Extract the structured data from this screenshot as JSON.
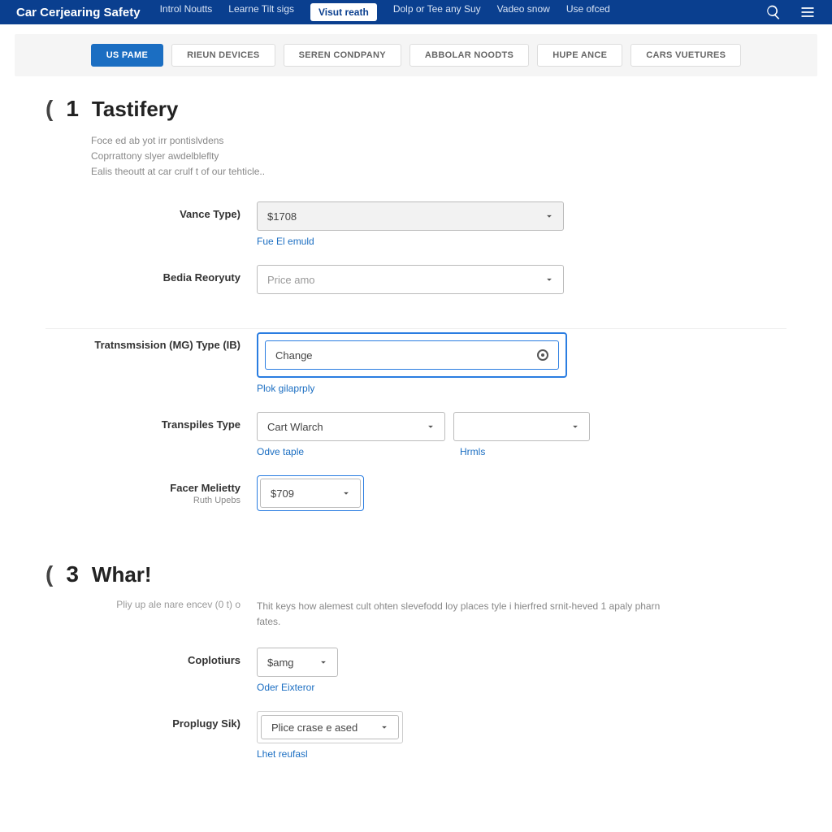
{
  "header": {
    "brand": "Car Cerjearing Safety",
    "nav": [
      "Introl Noutts",
      "Learne Tilt sigs",
      "Visut reath",
      "Dolp or Tee any Suy",
      "Vadeo snow",
      "Use ofced"
    ],
    "activeNavIndex": 2
  },
  "tabs": {
    "items": [
      "US PAME",
      "RIEUN DEVICES",
      "SEREN CONDPANY",
      "ABBOLAR NOODTS",
      "HUPE ANCE",
      "CARS VUETURES"
    ],
    "activeIndex": 0
  },
  "section1": {
    "num": "1",
    "title": "Tastifery",
    "intro": "Foce ed ab yot irr pontislvdens\nCoprrattony slyer awdelbleflty\nEalis theoutt at car crulf t of our tehticle..",
    "fields": {
      "vanceType": {
        "label": "Vance Type)",
        "value": "$1708",
        "helper": "Fue El emuld"
      },
      "bediaReoryuty": {
        "label": "Bedia Reoryuty",
        "value": "Price amo"
      },
      "transmission": {
        "label": "Tratnsmsision (MG) Type (IB)",
        "value": "Change",
        "helper": "Plok gilaprply"
      },
      "transpiles": {
        "label": "Transpiles Type",
        "value1": "Cart Wlarch",
        "value2": "",
        "helper1": "Odve taple",
        "helper2": "Hrmls"
      },
      "facerMelietty": {
        "label": "Facer Melietty",
        "sublabel": "Ruth Upebs",
        "value": "$709"
      }
    }
  },
  "section3": {
    "num": "3",
    "title": "Whar!",
    "leftHint": "Pliy up ale nare encev (0 t) o",
    "rightIntro": "Thit keys how alemest cult ohten slevefodd loy places tyle i hierfred srnit-heved 1 apaly pharn fates.",
    "fields": {
      "coplotiurs": {
        "label": "Coplotiurs",
        "value": "$amg",
        "helper": "Oder Eixteror"
      },
      "proplugy": {
        "label": "Proplugy Sik)",
        "value": "Plice crase e ased",
        "helper": "Lhet reufasl"
      }
    }
  }
}
